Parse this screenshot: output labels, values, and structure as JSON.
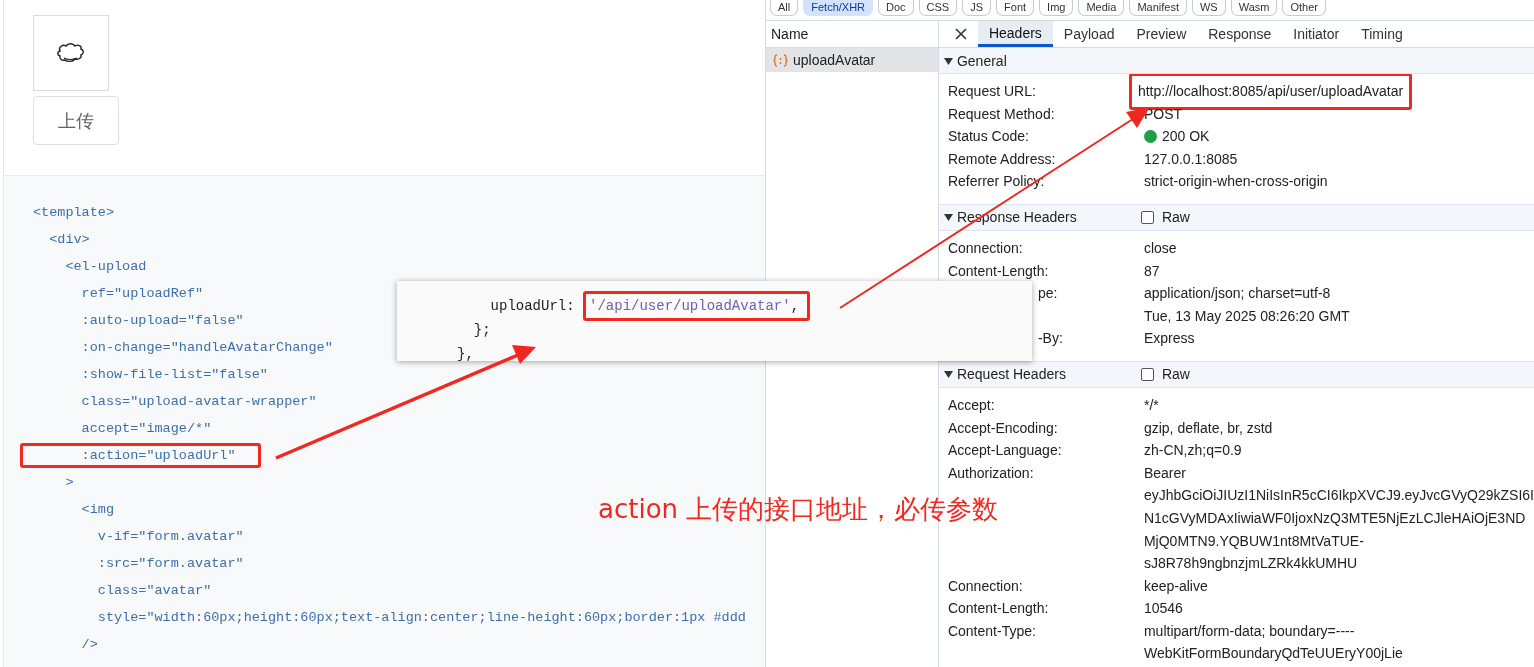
{
  "demo": {
    "upload_button": "上传"
  },
  "code_lines": [
    {
      "text": "<template>",
      "highlighted": false
    },
    {
      "text": "  <div>",
      "highlighted": false
    },
    {
      "text": "    <el-upload",
      "highlighted": false
    },
    {
      "text": "      ref=\"uploadRef\"",
      "highlighted": false
    },
    {
      "text": "      :auto-upload=\"false\"",
      "highlighted": false
    },
    {
      "text": "      :on-change=\"handleAvatarChange\"",
      "highlighted": false
    },
    {
      "text": "      :show-file-list=\"false\"",
      "highlighted": false
    },
    {
      "text": "      class=\"upload-avatar-wrapper\"",
      "highlighted": false
    },
    {
      "text": "      accept=\"image/*\"",
      "highlighted": false
    },
    {
      "text": "      :action=\"uploadUrl\"",
      "highlighted": true
    },
    {
      "text": "    >",
      "highlighted": false
    },
    {
      "text": "      <img",
      "highlighted": false
    },
    {
      "text": "        v-if=\"form.avatar\"",
      "highlighted": false
    },
    {
      "text": "        :src=\"form.avatar\"",
      "highlighted": false
    },
    {
      "text": "        class=\"avatar\"",
      "highlighted": false
    },
    {
      "text": "        style=\"width:60px;height:60px;text-align:center;line-height:60px;border:1px #ddd",
      "highlighted": false
    },
    {
      "text": "      />",
      "highlighted": false
    }
  ],
  "popup_code": [
    {
      "segments": [
        {
          "kind": "plain",
          "text": "    uploadUrl: "
        },
        {
          "kind": "box",
          "children": [
            {
              "kind": "string",
              "text": "'/api/user/uploadAvatar'"
            },
            {
              "kind": "plain",
              "text": ","
            }
          ]
        }
      ]
    },
    {
      "segments": [
        {
          "kind": "plain",
          "text": "  };"
        }
      ]
    },
    {
      "segments": [
        {
          "kind": "plain",
          "text": "},"
        }
      ]
    }
  ],
  "annotation": "action 上传的接口地址，必传参数",
  "devtools": {
    "filters": [
      {
        "label": "All",
        "selected": false
      },
      {
        "label": "Fetch/XHR",
        "selected": true
      },
      {
        "label": "Doc",
        "selected": false
      },
      {
        "label": "CSS",
        "selected": false
      },
      {
        "label": "JS",
        "selected": false
      },
      {
        "label": "Font",
        "selected": false
      },
      {
        "label": "Img",
        "selected": false
      },
      {
        "label": "Media",
        "selected": false
      },
      {
        "label": "Manifest",
        "selected": false
      },
      {
        "label": "WS",
        "selected": false
      },
      {
        "label": "Wasm",
        "selected": false
      },
      {
        "label": "Other",
        "selected": false
      }
    ],
    "request_list": {
      "header": "Name",
      "items": [
        {
          "name": "uploadAvatar",
          "selected": true
        }
      ]
    },
    "tabs": [
      {
        "label": "Headers",
        "selected": true
      },
      {
        "label": "Payload",
        "selected": false
      },
      {
        "label": "Preview",
        "selected": false
      },
      {
        "label": "Response",
        "selected": false
      },
      {
        "label": "Initiator",
        "selected": false
      },
      {
        "label": "Timing",
        "selected": false
      }
    ],
    "sections": [
      {
        "title": "General",
        "expanded": true,
        "rows": [
          {
            "kind": "boxed",
            "name": "Request URL:",
            "value": "http://localhost:8085/api/user/uploadAvatar"
          },
          {
            "kind": "plain",
            "name": "Request Method:",
            "value": "POST"
          },
          {
            "kind": "status",
            "name": "Status Code:",
            "value": "200 OK",
            "color": "#1e9e45"
          },
          {
            "kind": "plain",
            "name": "Remote Address:",
            "value": "127.0.0.1:8085"
          },
          {
            "kind": "plain",
            "name": "Referrer Policy:",
            "value": "strict-origin-when-cross-origin"
          }
        ]
      },
      {
        "title": "Response Headers",
        "expanded": true,
        "raw": {
          "label": "Raw",
          "checked": false
        },
        "rows": [
          {
            "kind": "plain",
            "name": "Connection:",
            "value": "close"
          },
          {
            "kind": "plain",
            "name": "Content-Length:",
            "value": "87"
          },
          {
            "kind": "clipped",
            "name": "pe:",
            "value": "application/json; charset=utf-8"
          },
          {
            "kind": "clipped",
            "value": "Tue, 13 May 2025 08:26:20 GMT"
          },
          {
            "kind": "clipped",
            "name": "-By:",
            "value": "Express"
          }
        ]
      },
      {
        "title": "Request Headers",
        "expanded": true,
        "raw": {
          "label": "Raw",
          "checked": false
        },
        "rows": [
          {
            "kind": "plain",
            "name": "Accept:",
            "value": "*/*"
          },
          {
            "kind": "plain",
            "name": "Accept-Encoding:",
            "value": "gzip, deflate, br, zstd"
          },
          {
            "kind": "plain",
            "name": "Accept-Language:",
            "value": "zh-CN,zh;q=0.9"
          },
          {
            "kind": "plain",
            "name": "Authorization:",
            "value_lines": [
              "Bearer",
              "eyJhbGciOiJIUzI1NiIsInR5cCI6IkpXVCJ9.eyJvcGVyQ29kZSI6I",
              "N1cGVyMDAxIiwiaWF0IjoxNzQ3MTE5NjEzLCJleHAiOjE3ND",
              "MjQ0MTN9.YQBUW1nt8MtVaTUE-",
              "sJ8R78h9ngbnzjmLZRk4kkUMHU"
            ]
          },
          {
            "kind": "plain",
            "name": "Connection:",
            "value": "keep-alive"
          },
          {
            "kind": "plain",
            "name": "Content-Length:",
            "value": "10546"
          },
          {
            "kind": "plain",
            "name": "Content-Type:",
            "value_lines": [
              "multipart/form-data; boundary=----",
              "WebKitFormBoundaryQdTeUUEryY00jLie"
            ]
          }
        ]
      }
    ]
  }
}
